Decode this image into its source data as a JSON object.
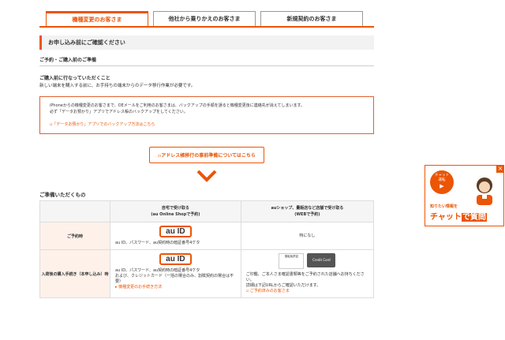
{
  "tabs": [
    {
      "label": "機種変更のお客さま"
    },
    {
      "label": "他社から乗りかえのお客さま"
    },
    {
      "label": "新規契約のお客さま"
    }
  ],
  "section_title": "お申し込み前にご確認ください",
  "subsection_title": "ご予約・ご購入前のご準備",
  "para_title": "ご購入前に行なっていただくこと",
  "para_text": "新しい端末を購入する前に、お手持ちの端末からのデータ移行作業が必要です。",
  "notice": {
    "line1": "iPhoneからの機種変更のお客さまで、ОEメールをご利用のお客さまは、バックアップの手順を誤ると機種変更後に連絡先が消えてしまいます。",
    "line2": "必ず「データお預かり」アプリでアドレス帳のバックアップをしてください。",
    "link": "「データお預かり」アプリでのバックアップ方法はこちら"
  },
  "address_button": "アドレス帳移行の事前準備についてはこちら",
  "table_title": "ご準備いただくもの",
  "table": {
    "col1_header": "自宅で受け取る\n(au Online Shopで予約)",
    "col2_header": "auショップ、量販店など店舗で受け取る\n(WEBで予約)",
    "row1": {
      "label": "ご予約時",
      "c1_logo": "au ID",
      "c1_text": "au ID、パスワード、au契約時の暗証番号4ケタ",
      "c2_text": "特になし"
    },
    "row2": {
      "label": "入荷後の購入手続き（本申し込み）時",
      "c1_logo": "au ID",
      "c1_text1": "au ID、パスワード、au契約時の暗証番号4ケタ",
      "c1_text2": "および、クレジットカード（一括の場合のみ、割賦契約の場合は不要）",
      "c1_link": "機種変更のお手続き方法",
      "c2_card1": "運転免許証",
      "c2_card2": "Credit Card",
      "c2_text1": "ご印鑑、ご本人さま確認書類等をご予約された店舗へお持ちください。",
      "c2_text2": "詳細は下記URLからご確認いただけます。",
      "c2_link": "ご予約済みのお客さま"
    }
  },
  "banner": {
    "chat_circle": "チャット\n運転",
    "small_text": "知りたい情報を",
    "big_text_1": "チャット",
    "big_text_2": "で質問",
    "close": "×"
  },
  "colors": {
    "accent": "#eb5505"
  }
}
